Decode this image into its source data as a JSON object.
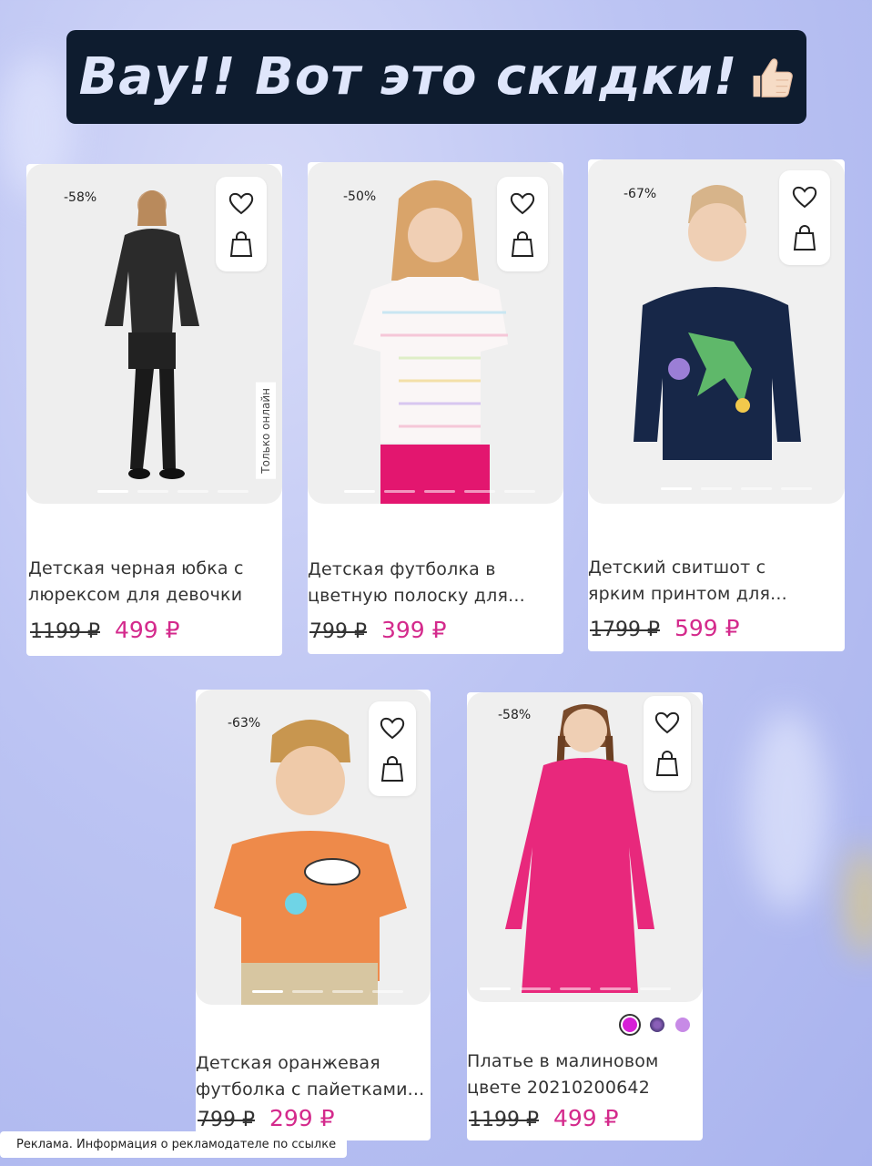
{
  "banner": {
    "title": "Вау!! Вот это скидки!",
    "emoji": "thumbs-up-icon"
  },
  "cards": [
    {
      "discount": "-58%",
      "title_line1": "Детская черная юбка с",
      "title_line2": "люрексом для девочки",
      "old_price": "1199 ₽",
      "new_price": "499 ₽",
      "tag": "Только онлайн"
    },
    {
      "discount": "-50%",
      "title_line1": "Детская футболка в",
      "title_line2": "цветную полоску для...",
      "old_price": "799 ₽",
      "new_price": "399 ₽"
    },
    {
      "discount": "-67%",
      "title_line1": "Детский свитшот с",
      "title_line2": "ярким принтом для...",
      "old_price": "1799 ₽",
      "new_price": "599 ₽"
    },
    {
      "discount": "-63%",
      "title_line1": "Детская оранжевая",
      "title_line2": "футболка с пайетками...",
      "old_price": "799 ₽",
      "new_price": "299 ₽"
    },
    {
      "discount": "-58%",
      "title_line1": "Платье в малиновом",
      "title_line2": "цвете 20210200642",
      "old_price": "1199 ₽",
      "new_price": "499 ₽"
    }
  ],
  "colors": {
    "price": "#d42a8c",
    "banner_bg": "#0e1c2f",
    "swatch_selected": "#d61fd6",
    "swatch_lilac": "#c78ae6"
  },
  "ad_notice": "Реклама. Информация о рекламодателе по ссылке"
}
